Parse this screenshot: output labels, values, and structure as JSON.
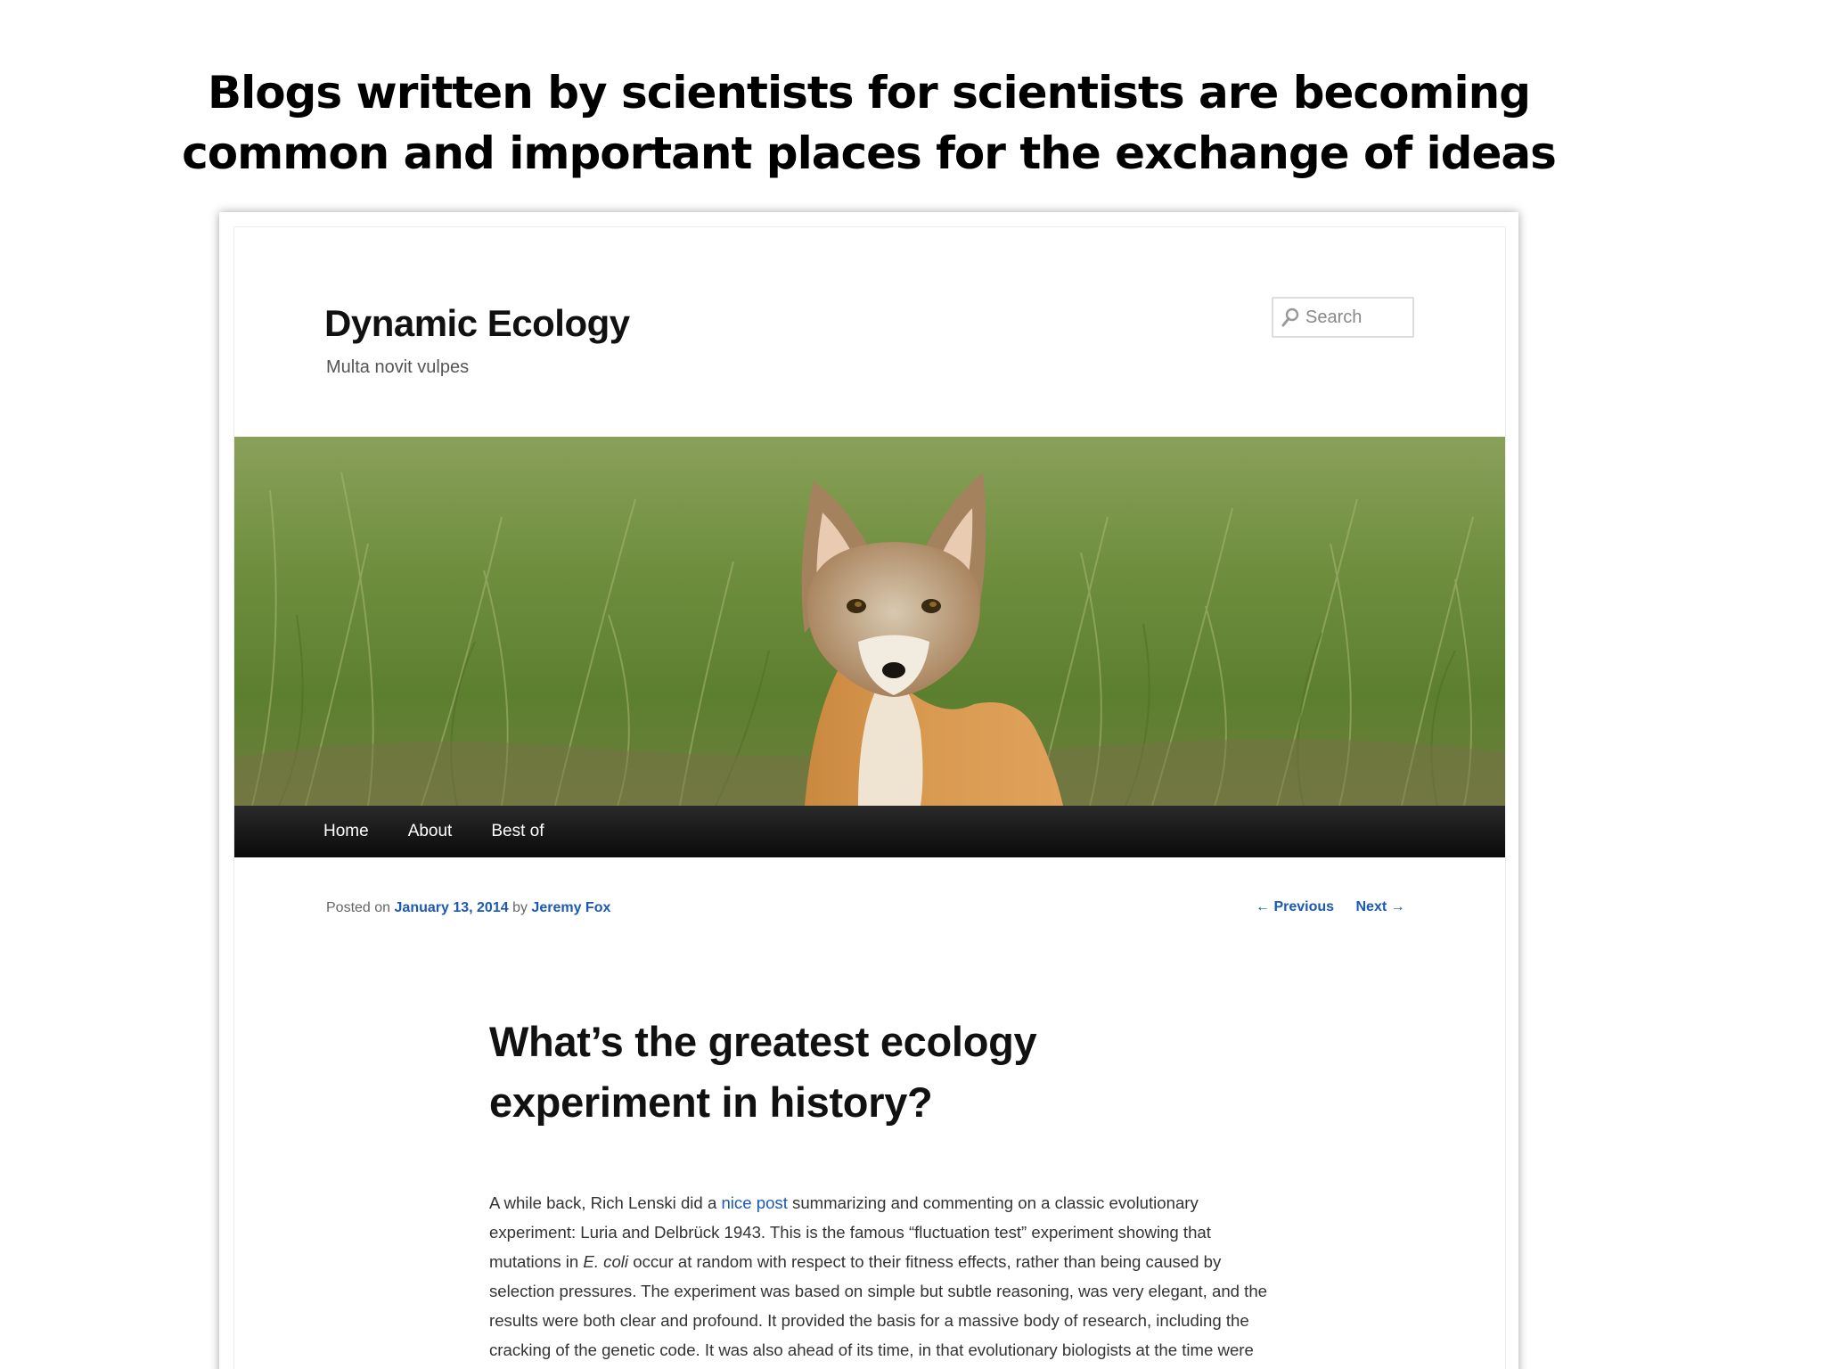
{
  "slide": {
    "title_line1": "Blogs written by scientists for scientists are becoming",
    "title_line2": "common and important places for the exchange of ideas"
  },
  "site": {
    "title": "Dynamic Ecology",
    "tagline": "Multa novit vulpes"
  },
  "search": {
    "placeholder": "Search"
  },
  "header_image": {
    "subject": "fox sitting in green grass"
  },
  "nav": {
    "items": [
      "Home",
      "About",
      "Best of"
    ]
  },
  "post_meta": {
    "posted_on": "Posted on",
    "date": "January 13, 2014",
    "by": "by",
    "author": "Jeremy Fox"
  },
  "post_nav": {
    "previous": "← Previous",
    "next": "Next →"
  },
  "post": {
    "title": "What’s the greatest ecology experiment in history?",
    "body": {
      "s1_before_link": "A while back, Rich Lenski did a ",
      "link_text": "nice post",
      "s1_after_link": " summarizing and commenting on a classic evolutionary experiment: Luria and Delbrück 1943. This is the famous “fluctuation test” experiment showing that mutations in ",
      "italic_organism": "E. coli",
      "s1_rest": " occur at random with respect to their fitness effects, rather than being caused by selection pressures. The experiment was based on simple but subtle reasoning, was very elegant, and the results were both clear and profound. It provided the basis for a massive body of research, including the cracking of the genetic code. It was also ahead of its time, in that evolutionary biologists at the time were mostly"
    }
  },
  "colors": {
    "link": "#1b59b3",
    "nav_bg": "#111111",
    "text": "#333333"
  }
}
